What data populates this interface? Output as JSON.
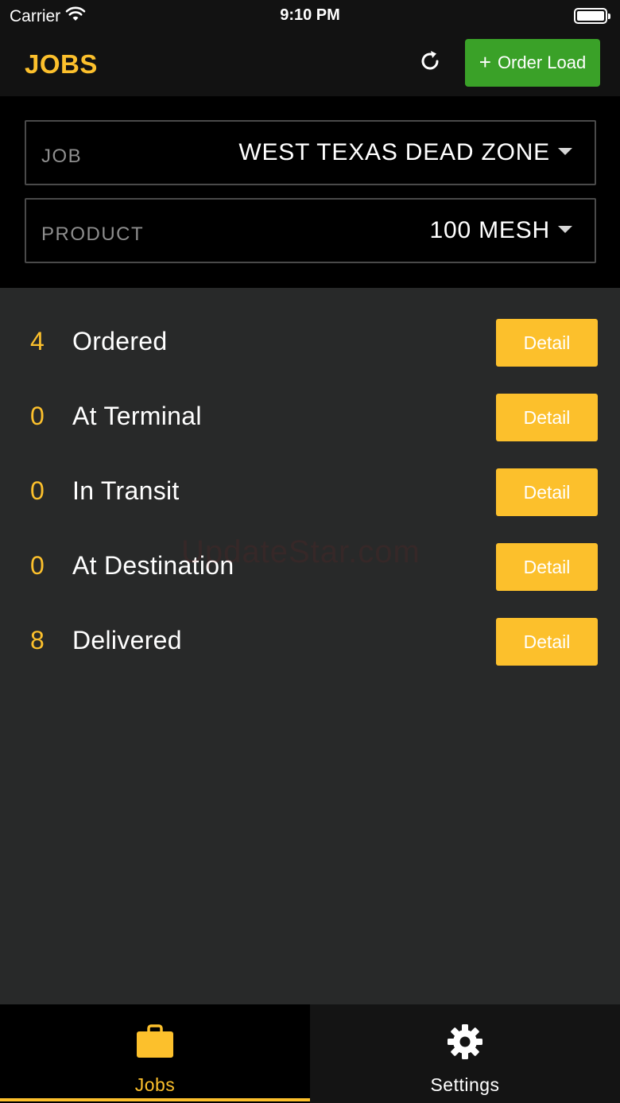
{
  "status_bar": {
    "carrier": "Carrier",
    "time": "9:10 PM",
    "wifi_icon": "wifi-icon",
    "battery_icon": "battery-icon"
  },
  "nav": {
    "title": "JOBS",
    "refresh_icon": "refresh-icon",
    "order_button": {
      "icon": "plus",
      "plus": "+",
      "label": "Order Load"
    }
  },
  "filters": {
    "job": {
      "label": "JOB",
      "value": "WEST TEXAS DEAD ZONE"
    },
    "product": {
      "label": "PRODUCT",
      "value": "100 MESH"
    }
  },
  "statuses": [
    {
      "count": "4",
      "label": "Ordered",
      "button": "Detail"
    },
    {
      "count": "0",
      "label": "At Terminal",
      "button": "Detail"
    },
    {
      "count": "0",
      "label": "In Transit",
      "button": "Detail"
    },
    {
      "count": "0",
      "label": "At Destination",
      "button": "Detail"
    },
    {
      "count": "8",
      "label": "Delivered",
      "button": "Detail"
    }
  ],
  "watermark": "UpdateStar.com",
  "tabs": [
    {
      "label": "Jobs",
      "icon": "briefcase-icon",
      "selected": true
    },
    {
      "label": "Settings",
      "icon": "gear-icon",
      "selected": false
    }
  ],
  "colors": {
    "accent": "#fcc02c",
    "order_button": "#3aa128",
    "background": "#282929",
    "header": "#121212"
  }
}
